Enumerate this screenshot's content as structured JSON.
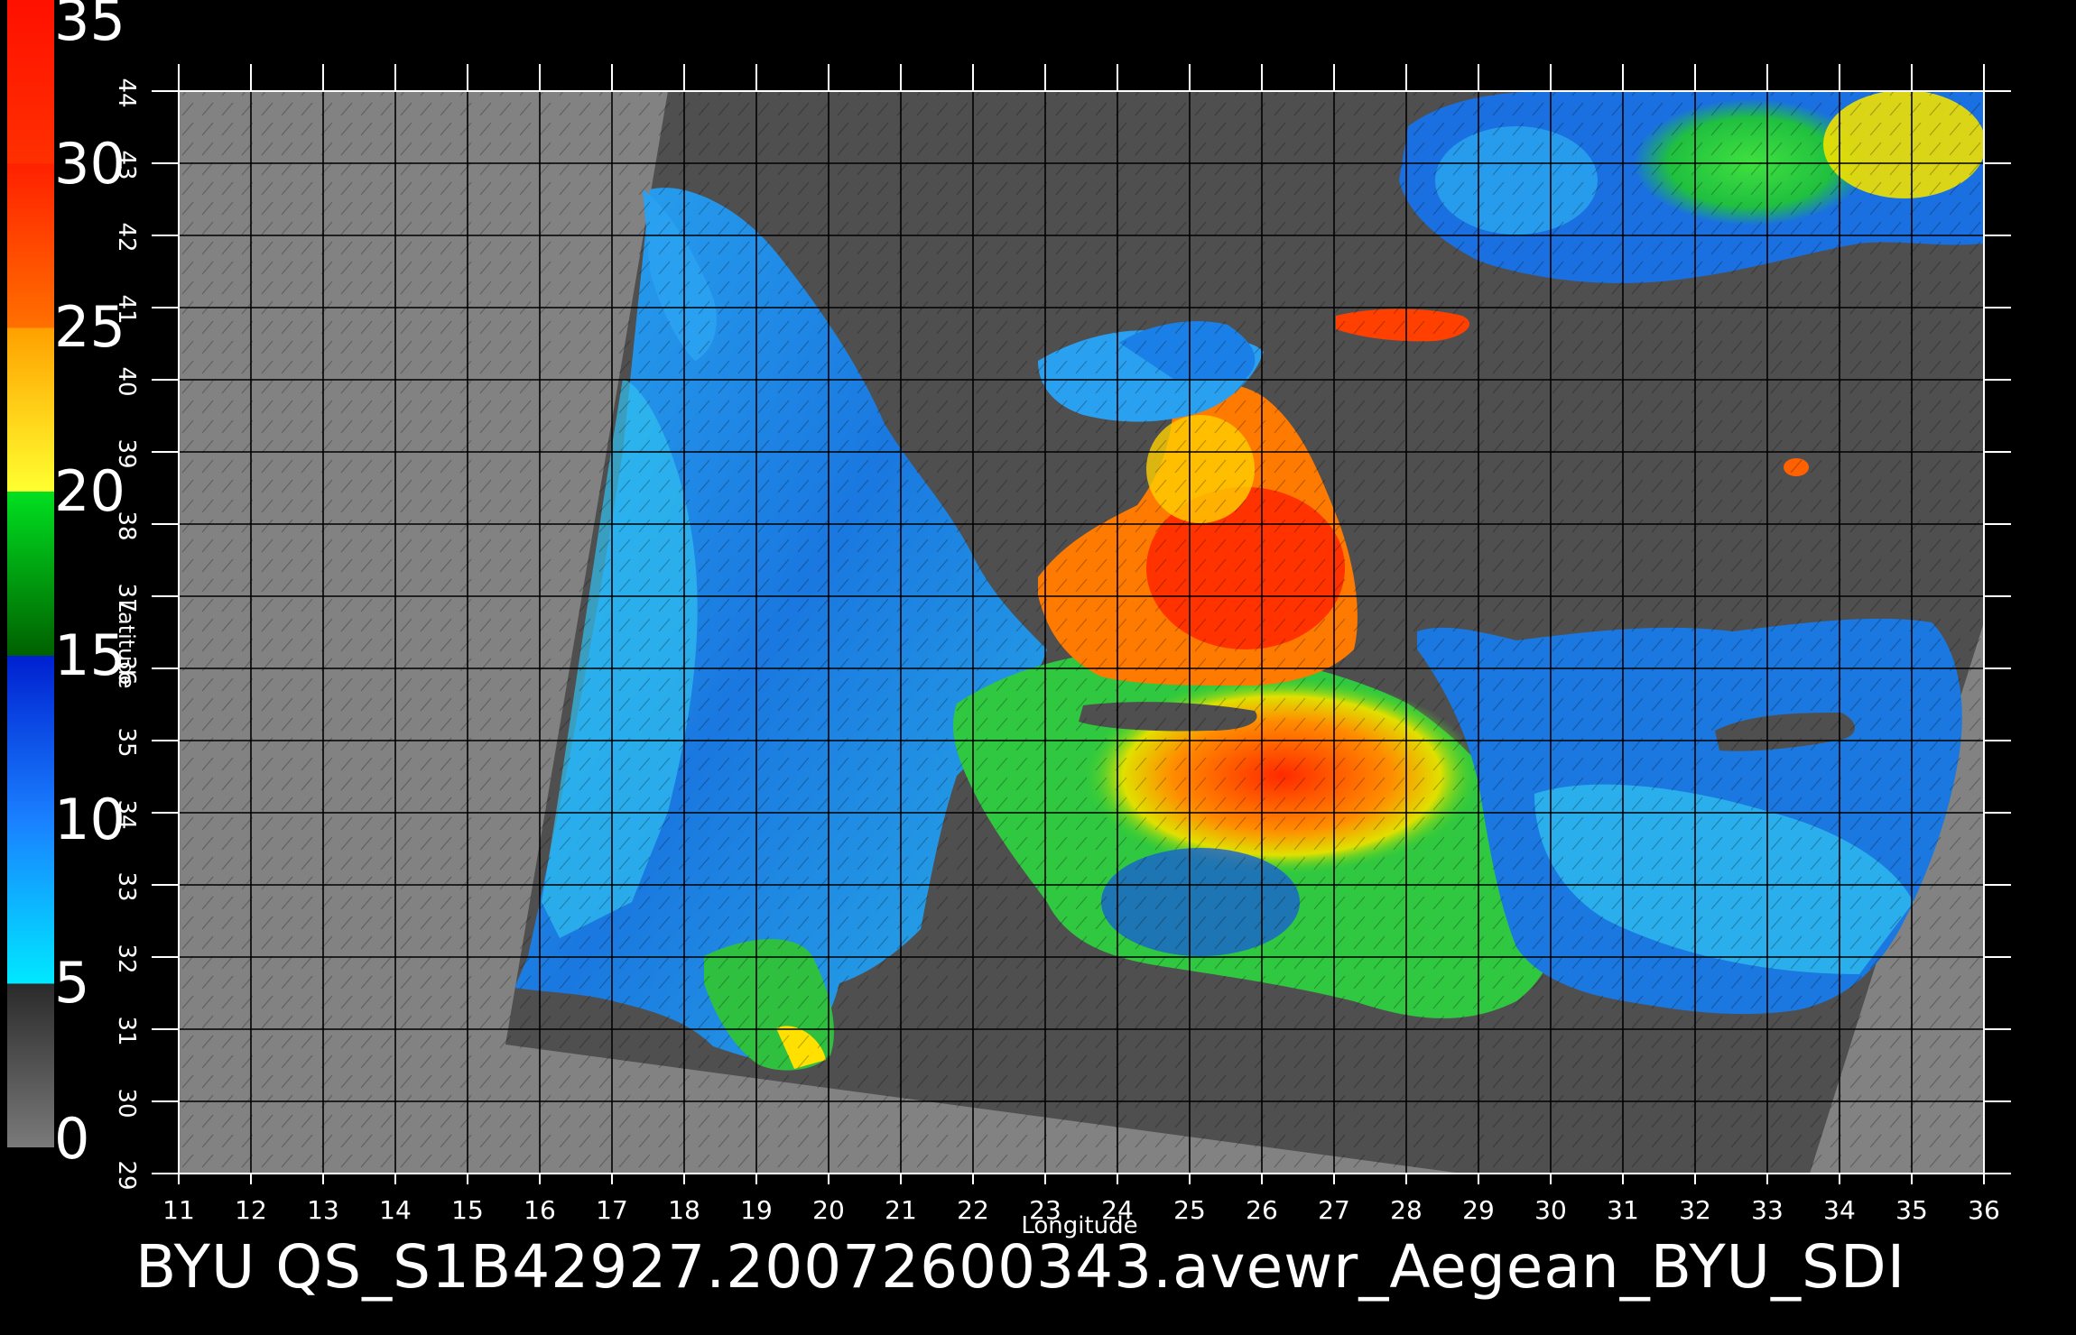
{
  "map": {
    "xlabel": "Longitude",
    "ylabel": "Latitude",
    "lon_ticks": [
      "11",
      "12",
      "13",
      "14",
      "15",
      "16",
      "17",
      "18",
      "19",
      "20",
      "21",
      "22",
      "23",
      "24",
      "25",
      "26",
      "27",
      "28",
      "29",
      "30",
      "31",
      "32",
      "33",
      "34",
      "35",
      "36"
    ],
    "lat_ticks": [
      "29",
      "30",
      "31",
      "32",
      "33",
      "34",
      "35",
      "36",
      "37",
      "38",
      "39",
      "40",
      "41",
      "42",
      "43",
      "44"
    ],
    "lon_range": [
      11,
      36
    ],
    "lat_range": [
      29,
      44
    ],
    "grid": true,
    "colors": {
      "outside_swath": "#828282",
      "land_in_swath": "#505050",
      "low_wind_sea": "#1a7be0",
      "mid_wind_sea": "#2cb0e8",
      "high_wind_sea": "#ff3a00"
    }
  },
  "colorbar": {
    "labels": [
      "35",
      "30",
      "25",
      "20",
      "15",
      "10",
      "5",
      "0"
    ],
    "range": [
      0,
      35
    ],
    "stops": [
      {
        "value": 0,
        "color": "#7a7a7a"
      },
      {
        "value": 5,
        "color": "#2a2a2a"
      },
      {
        "value": 5,
        "color": "#00e8ff"
      },
      {
        "value": 10,
        "color": "#1a80ff"
      },
      {
        "value": 15,
        "color": "#0020d0"
      },
      {
        "value": 15,
        "color": "#006000"
      },
      {
        "value": 20,
        "color": "#00e020"
      },
      {
        "value": 20,
        "color": "#ffff30"
      },
      {
        "value": 25,
        "color": "#ffa000"
      },
      {
        "value": 25,
        "color": "#ff7000"
      },
      {
        "value": 30,
        "color": "#ff2000"
      },
      {
        "value": 30,
        "color": "#ff3000"
      },
      {
        "value": 35,
        "color": "#ff1000"
      },
      {
        "value": 35,
        "color": "#c08060"
      }
    ]
  },
  "footer": {
    "title": "BYU  QS_S1B42927.20072600343.avewr_Aegean_BYU_SDI"
  }
}
